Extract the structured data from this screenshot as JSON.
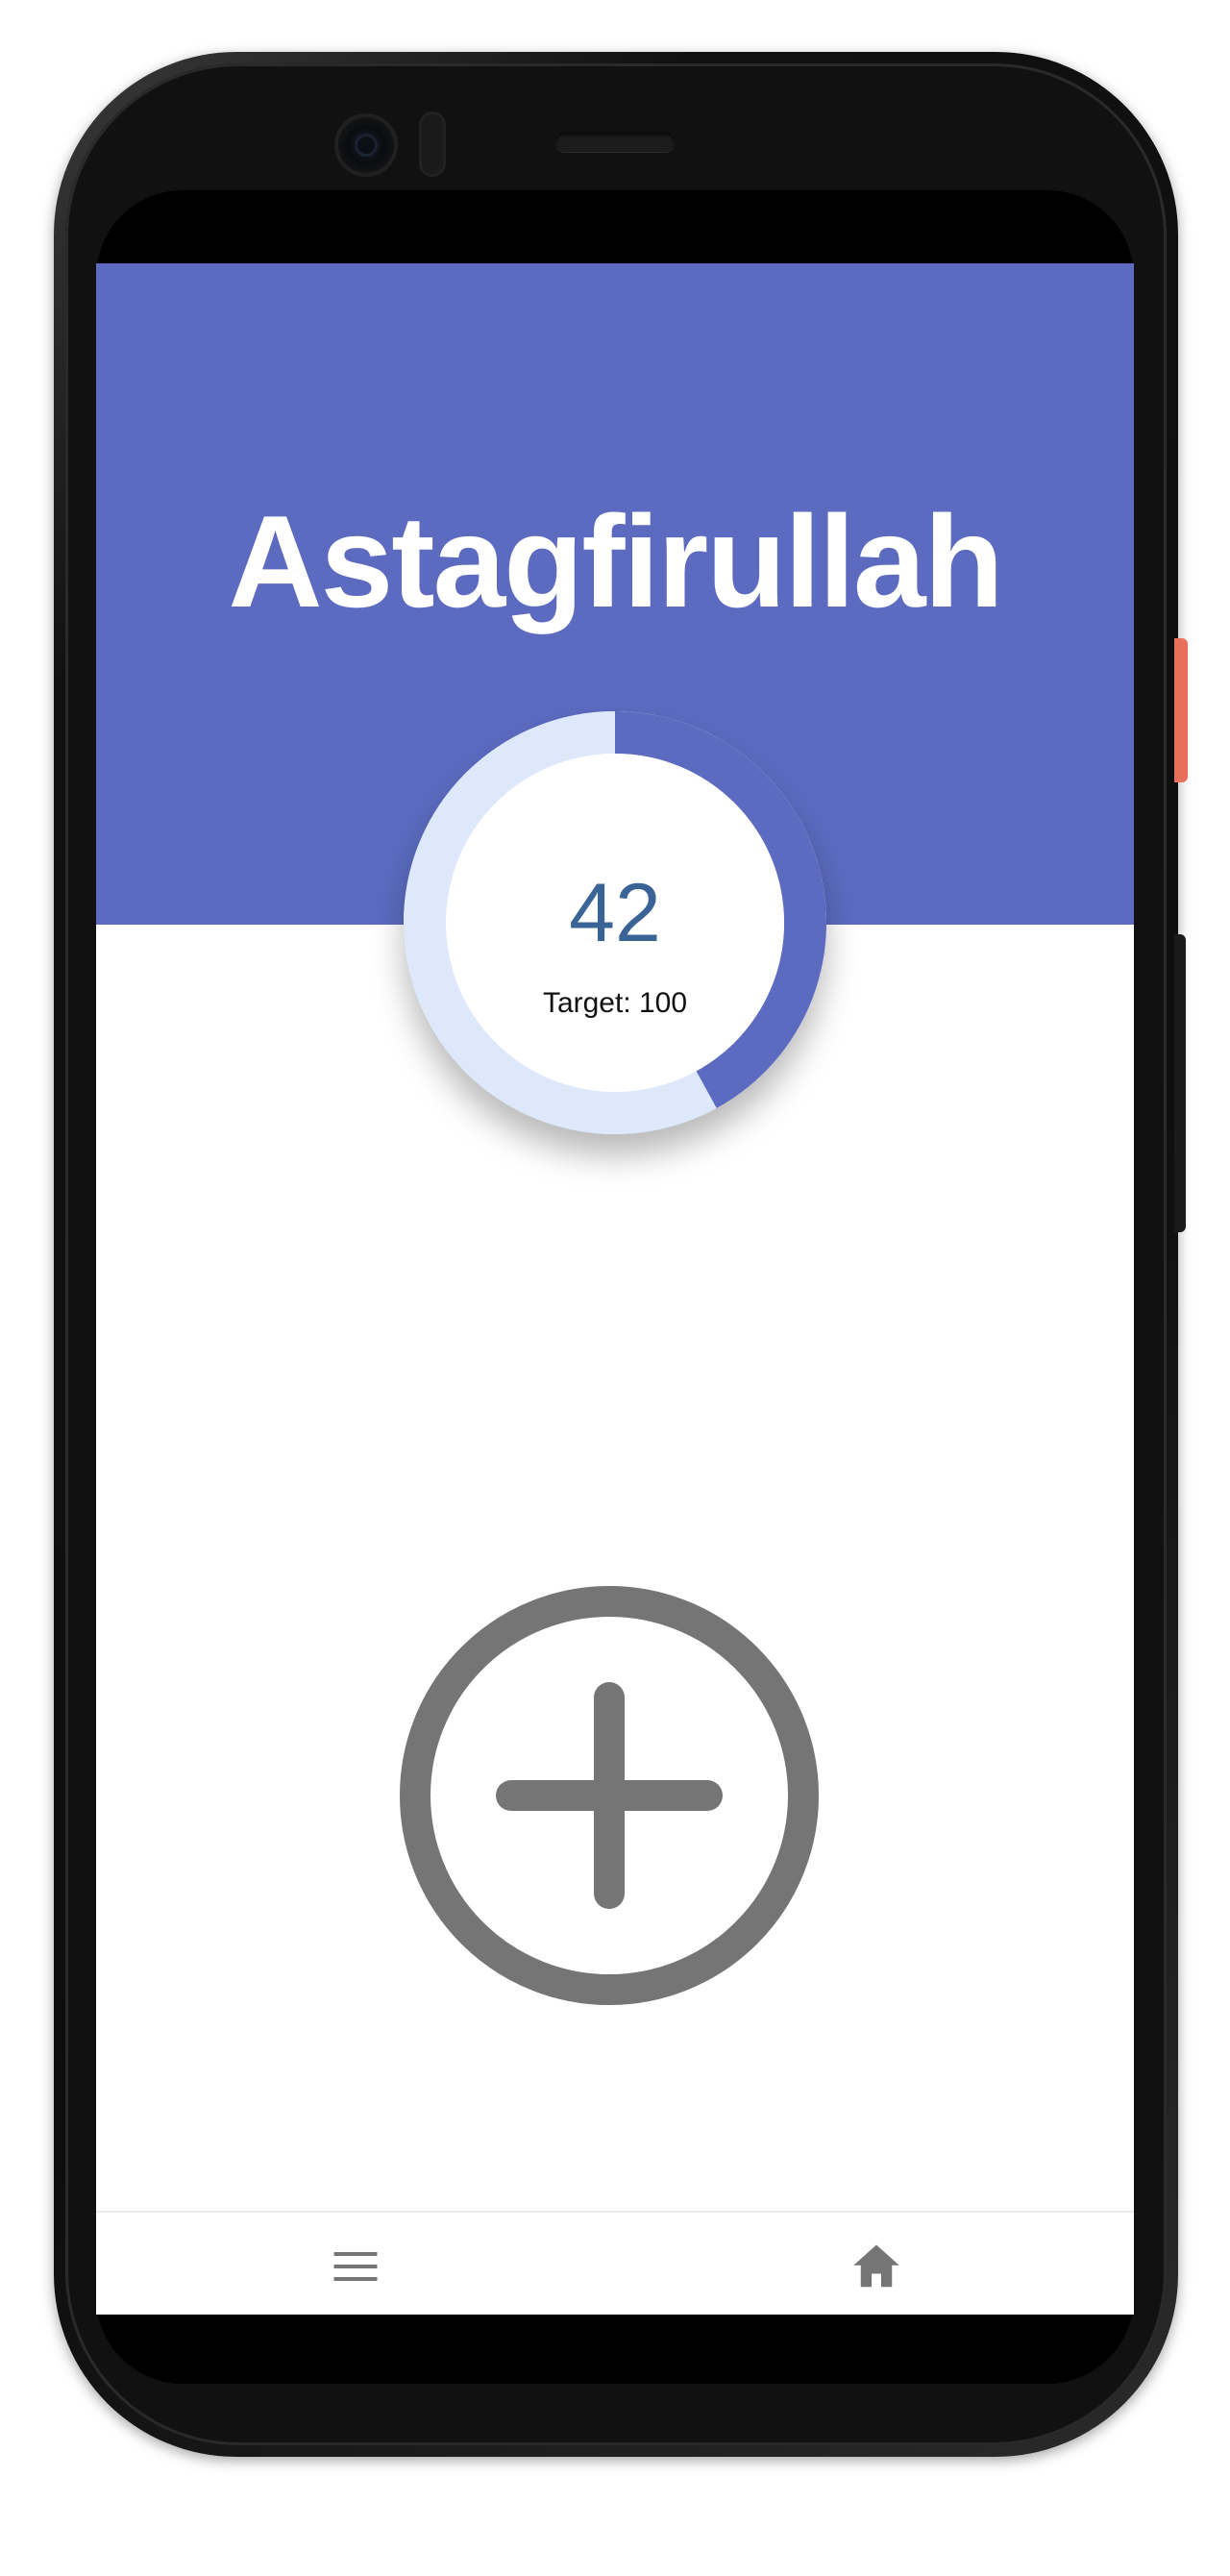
{
  "app": {
    "title": "Astagfirullah"
  },
  "counter": {
    "count": "42",
    "target_text": "Target: 100",
    "count_value": 42,
    "target_value": 100,
    "progress_fraction": 0.42
  },
  "actions": {
    "increment_icon": "plus-circle-icon"
  },
  "bottom_nav": {
    "items": [
      {
        "icon": "menu-icon"
      },
      {
        "icon": "home-icon"
      }
    ]
  },
  "colors": {
    "header": "#5c6bc0",
    "ring_progress": "#5c6bc0",
    "ring_track": "#dde9fb",
    "count_text": "#3a6496",
    "add_button": "#757575",
    "nav_icon": "#757575"
  }
}
